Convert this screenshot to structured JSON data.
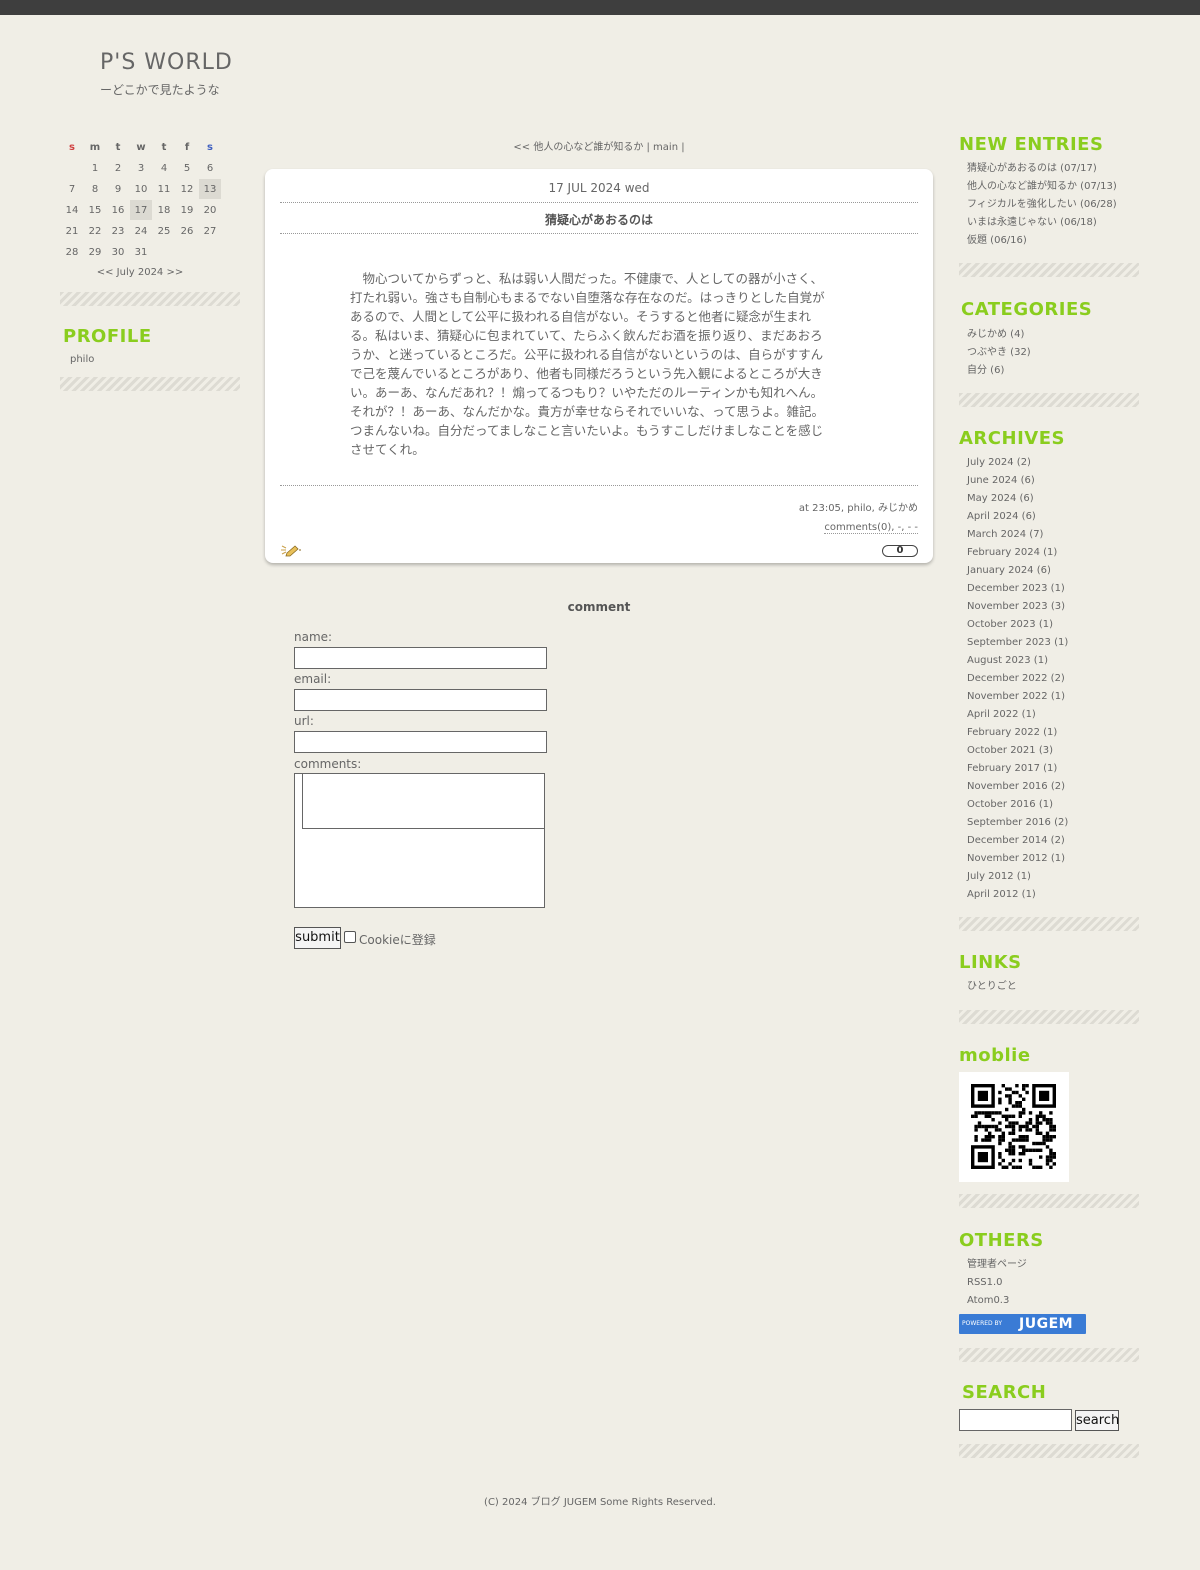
{
  "site": {
    "title": "P'S WORLD",
    "subtitle": "ーどこかで見たような"
  },
  "calendar": {
    "weekdays": [
      "s",
      "m",
      "t",
      "w",
      "t",
      "f",
      "s"
    ],
    "weeks": [
      [
        "",
        "1",
        "2",
        "3",
        "4",
        "5",
        "6"
      ],
      [
        "7",
        "8",
        "9",
        "10",
        "11",
        "12",
        "13"
      ],
      [
        "14",
        "15",
        "16",
        "17",
        "18",
        "19",
        "20"
      ],
      [
        "21",
        "22",
        "23",
        "24",
        "25",
        "26",
        "27"
      ],
      [
        "28",
        "29",
        "30",
        "31",
        "",
        "",
        ""
      ]
    ],
    "highlighted": [
      "13",
      "17"
    ],
    "nav": "<< July 2024 >>"
  },
  "profile": {
    "heading": "PROFILE",
    "name": "philo"
  },
  "entry_nav": "<< 他人の心など誰が知るか | main |",
  "entry": {
    "date": "17 JUL 2024 wed",
    "title": "猜疑心があおるのは",
    "body_lines": [
      "　物心ついてからずっと、私は弱い人間だった。不健康で、人としての器が小さく、",
      "打たれ弱い。強さも自制心もまるでない自堕落な存在なのだ。はっきりとした自覚が",
      "あるので、人間として公平に扱われる自信がない。そうすると他者に疑念が生まれ",
      "る。私はいま、猜疑心に包まれていて、たらふく飲んだお酒を振り返り、まだあおろ",
      "うか、と迷っているところだ。公平に扱われる自信がないというのは、自らがすすん",
      "で己を蔑んでいるところがあり、他者も同様だろうという先入観によるところが大き",
      "い。あーあ、なんだあれ？！煽ってるつもり？いやただのルーティンかも知れへん。",
      "それが？！あーあ、なんだかな。貴方が幸せならそれでいいな、って思うよ。雑記。",
      "つまんないね。自分だってましなこと言いたいよ。もうすこしだけましなことを感じ",
      "させてくれ。"
    ],
    "meta_line1": "at 23:05, philo, みじかめ",
    "meta_line2": "comments(0), -, - -",
    "count": "0"
  },
  "comment_form": {
    "heading": "comment",
    "name_label": "name:",
    "email_label": "email:",
    "url_label": "url:",
    "comments_label": "comments:",
    "submit_label": "submit",
    "cookie_label": "Cookieに登録"
  },
  "new_entries": {
    "heading": "NEW ENTRIES",
    "items": [
      "猜疑心があおるのは (07/17)",
      "他人の心など誰が知るか (07/13)",
      "フィジカルを強化したい (06/28)",
      "いまは永遠じゃない (06/18)",
      "仮題 (06/16)"
    ]
  },
  "categories": {
    "heading": "CATEGORIES",
    "items": [
      "みじかめ (4)",
      "つぶやき (32)",
      "自分 (6)"
    ]
  },
  "archives": {
    "heading": "ARCHIVES",
    "items": [
      "July 2024 (2)",
      "June 2024 (6)",
      "May 2024 (6)",
      "April 2024 (6)",
      "March 2024 (7)",
      "February 2024 (1)",
      "January 2024 (6)",
      "December 2023 (1)",
      "November 2023 (3)",
      "October 2023 (1)",
      "September 2023 (1)",
      "August 2023 (1)",
      "December 2022 (2)",
      "November 2022 (1)",
      "April 2022 (1)",
      "February 2022 (1)",
      "October 2021 (3)",
      "February 2017 (1)",
      "November 2016 (2)",
      "October 2016 (1)",
      "September 2016 (2)",
      "December 2014 (2)",
      "November 2012 (1)",
      "July 2012 (1)",
      "April 2012 (1)"
    ]
  },
  "links": {
    "heading": "LINKS",
    "items": [
      "ひとりごと"
    ]
  },
  "mobile": {
    "heading": "moblie"
  },
  "others": {
    "heading": "OTHERS",
    "items": [
      "管理者ページ",
      "RSS1.0",
      "Atom0.3"
    ],
    "badge_small": "POWERED BY",
    "badge_big": "JUGEM",
    "badge_color": "#3a7bd5"
  },
  "search": {
    "heading": "SEARCH",
    "button_label": "search"
  },
  "footer": "(C) 2024 ブログ JUGEM Some Rights Reserved.",
  "colors": {
    "accent": "#8acd1e",
    "background": "#f0eee6",
    "topbar": "#3e3e3e"
  }
}
